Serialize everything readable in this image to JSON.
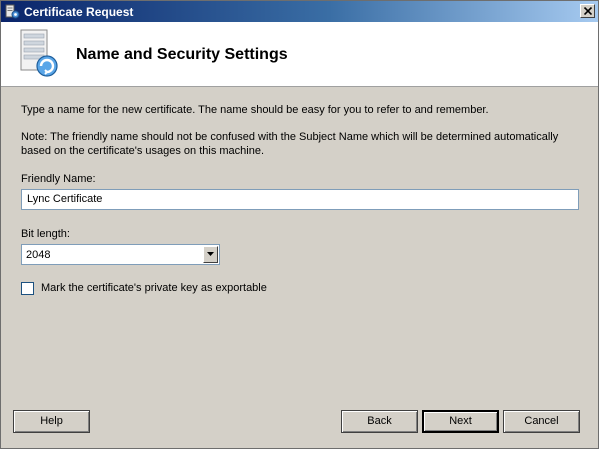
{
  "window": {
    "title": "Certificate Request",
    "close_glyph": "×"
  },
  "header": {
    "title": "Name and Security Settings",
    "icon": "certificate-server-icon"
  },
  "body": {
    "intro": "Type a name for the new certificate. The name should be easy for you to refer to and remember.",
    "note_line1": "Note: The friendly name should not be confused with the Subject Name which will be determined automatically",
    "note_line2": "based on the certificate's usages on this machine.",
    "friendly_name_label": "Friendly Name:",
    "friendly_name_value": "Lync Certificate",
    "bit_length_label": "Bit length:",
    "bit_length_value": "2048",
    "exportable_label": "Mark the certificate's private key as exportable",
    "exportable_checked": false
  },
  "buttons": {
    "help": "Help",
    "back": "Back",
    "next": "Next",
    "cancel": "Cancel"
  },
  "colors": {
    "title_bar_start": "#0a246a",
    "title_bar_end": "#a6caf0",
    "dialog_background": "#d4d0c8",
    "header_background": "#ffffff",
    "input_border": "#7f9db9"
  }
}
